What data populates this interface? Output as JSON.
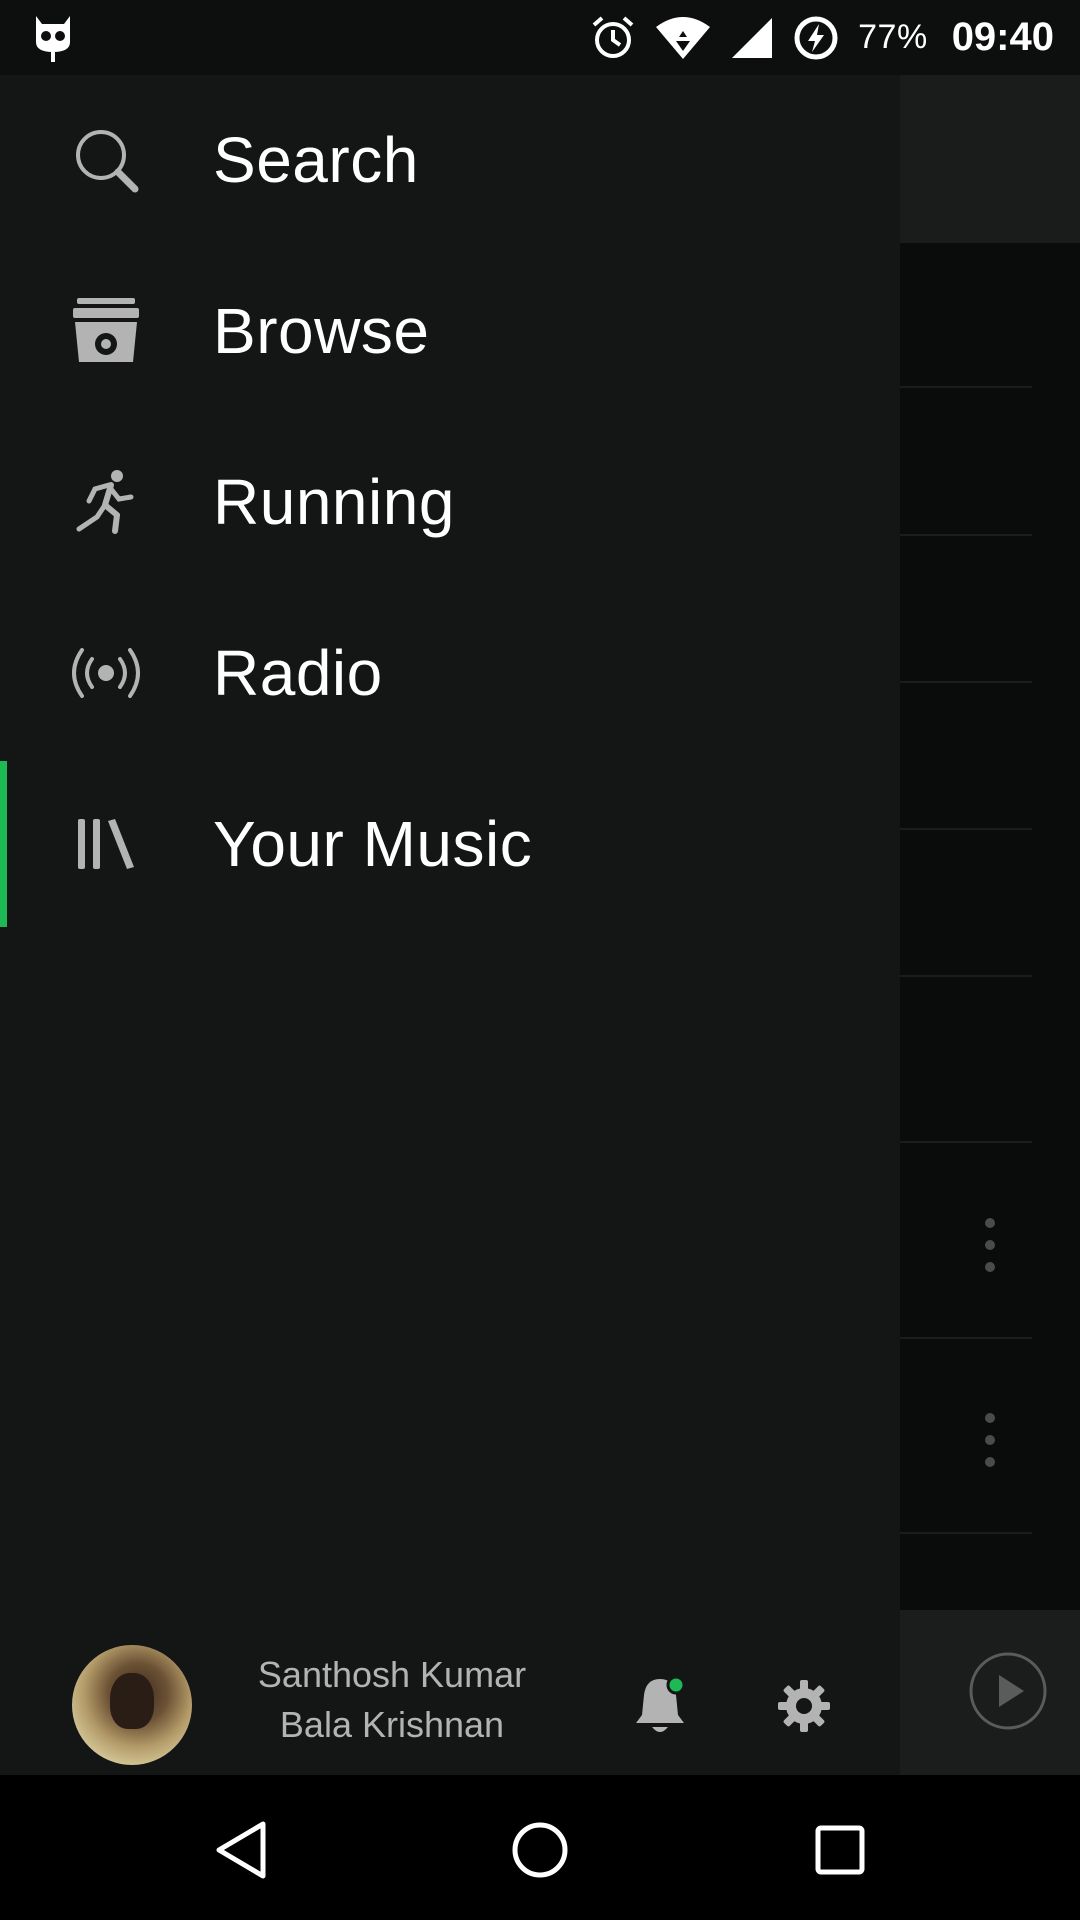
{
  "status_bar": {
    "battery_percent": "77%",
    "time": "09:40",
    "icons": [
      "cyanogen-icon",
      "alarm-icon",
      "wifi-icon",
      "signal-icon",
      "battery-charging-icon"
    ]
  },
  "drawer": {
    "menu": [
      {
        "label": "Search",
        "icon": "search-icon",
        "active": false
      },
      {
        "label": "Browse",
        "icon": "browse-icon",
        "active": false
      },
      {
        "label": "Running",
        "icon": "running-icon",
        "active": false
      },
      {
        "label": "Radio",
        "icon": "radio-icon",
        "active": false
      },
      {
        "label": "Your Music",
        "icon": "library-icon",
        "active": true
      }
    ],
    "footer": {
      "user_name_line1": "Santhosh Kumar",
      "user_name_line2": "Bala Krishnan",
      "notification_indicator": true
    }
  },
  "colors": {
    "accent": "#1db954",
    "drawer_bg": "#141616",
    "text_primary": "#ffffff",
    "text_secondary": "#b3b3b3"
  },
  "nav_bar": {
    "buttons": [
      "back-icon",
      "home-icon",
      "recents-icon"
    ]
  }
}
